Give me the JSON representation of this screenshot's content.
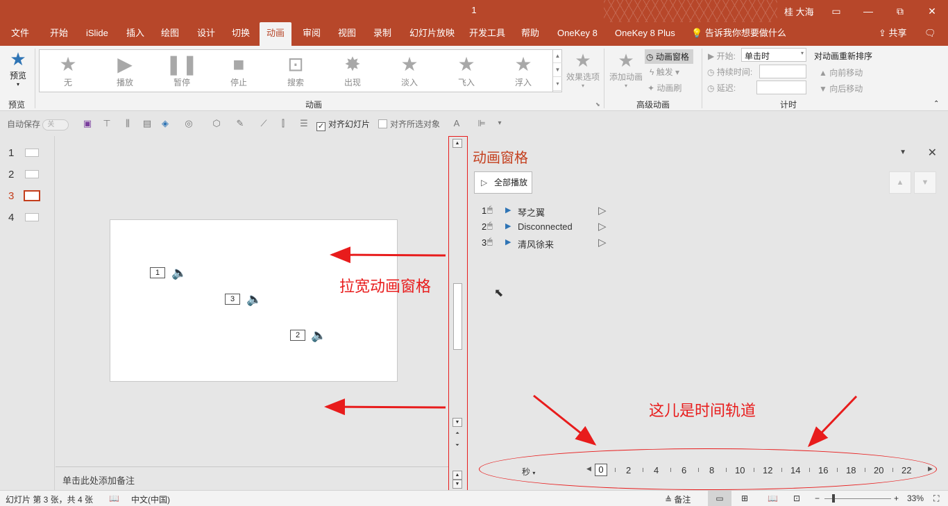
{
  "window": {
    "doc_title": "1",
    "user": "桂 大海",
    "restore": "⧉",
    "minimize": "—",
    "close": "✕"
  },
  "tabs": [
    "文件",
    "开始",
    "iSlide",
    "插入",
    "绘图",
    "设计",
    "切换",
    "动画",
    "审阅",
    "视图",
    "录制",
    "幻灯片放映",
    "开发工具",
    "帮助",
    "OneKey 8",
    "OneKey 8 Plus",
    "告诉我你想要做什么",
    "共享"
  ],
  "ribbon": {
    "preview_label": "预览",
    "group_preview": "预览",
    "group_animation": "动画",
    "group_advanced": "高级动画",
    "group_timing": "计时",
    "gallery": [
      "无",
      "播放",
      "暂停",
      "停止",
      "搜索",
      "出现",
      "淡入",
      "飞入",
      "浮入"
    ],
    "effect_options": "效果选项",
    "add_animation": "添加动画",
    "animation_pane": "动画窗格",
    "trigger": "触发",
    "painter": "动画刷",
    "start_label": "开始:",
    "start_value": "单击时",
    "duration_label": "持续时间:",
    "delay_label": "延迟:",
    "reorder_title": "对动画重新排序",
    "move_earlier": "向前移动",
    "move_later": "向后移动"
  },
  "qat": {
    "autosave": "自动保存",
    "autosave_state": "关",
    "align_slide": "对齐幻灯片",
    "align_selected": "对齐所选对象"
  },
  "thumbnails": [
    "1",
    "2",
    "3",
    "4"
  ],
  "slide": {
    "tags": [
      "1",
      "3",
      "2"
    ]
  },
  "notes_placeholder": "单击此处添加备注",
  "annotations": {
    "widen_pane": "拉宽动画窗格",
    "timeline_here": "这儿是时间轨道"
  },
  "pane": {
    "title": "动画窗格",
    "play_all": "全部播放",
    "items": [
      {
        "index": "1",
        "name": "琴之翼"
      },
      {
        "index": "2",
        "name": "Disconnected"
      },
      {
        "index": "3",
        "name": "清风徐来"
      }
    ],
    "timeline_unit": "秒",
    "timeline_ticks": [
      "0",
      "2",
      "4",
      "6",
      "8",
      "10",
      "12",
      "14",
      "16",
      "18",
      "20",
      "22"
    ]
  },
  "status": {
    "slide_info": "幻灯片 第 3 张，共 4 张",
    "language": "中文(中国)",
    "notes": "备注",
    "zoom": "33%"
  },
  "colors": {
    "accent": "#b7472a",
    "annotation": "#e81c1c"
  }
}
